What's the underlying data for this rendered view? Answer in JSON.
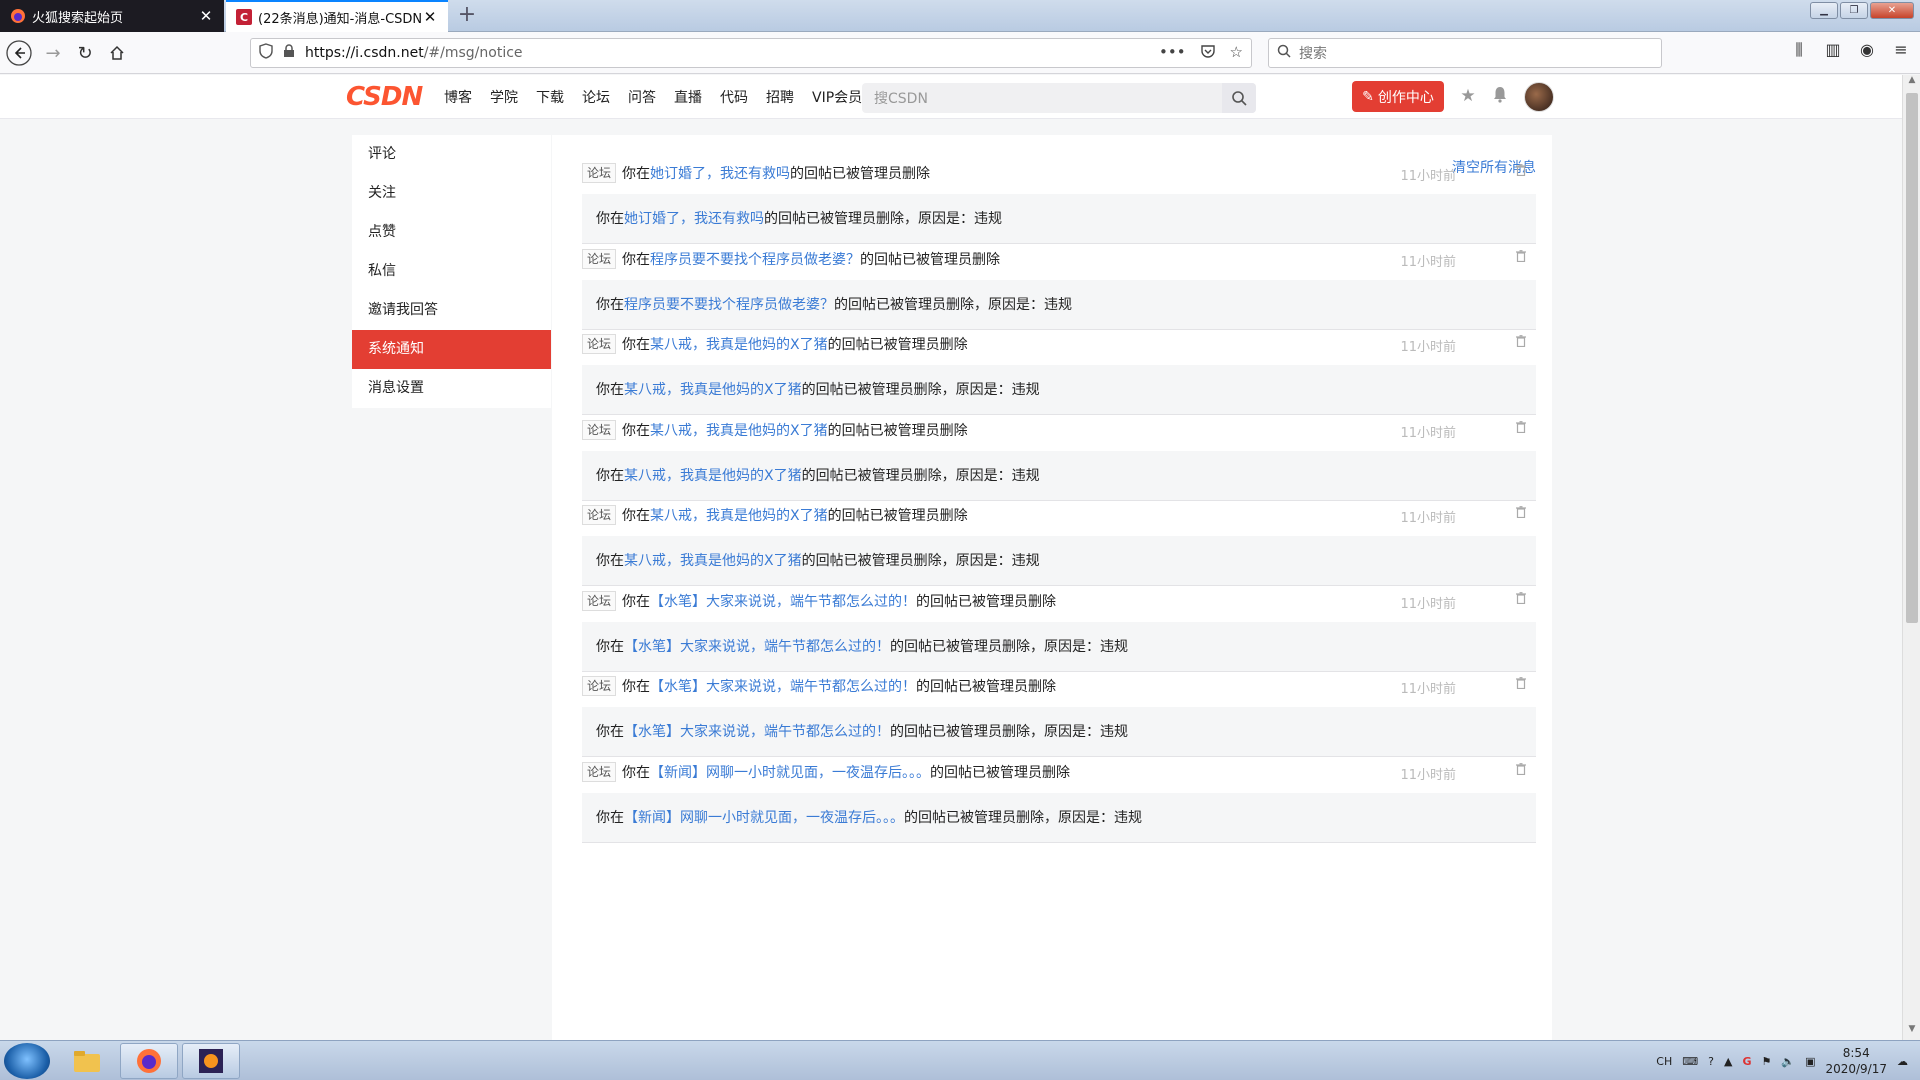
{
  "browser": {
    "tabs": [
      {
        "title": "火狐搜索起始页",
        "active": false
      },
      {
        "title": "(22条消息)通知-消息-CSDN",
        "active": true
      }
    ],
    "url_host": "https://i.csdn.net",
    "url_path": "/#/msg/notice",
    "search_placeholder": "搜索"
  },
  "site": {
    "logo": "CSDN",
    "nav": [
      "博客",
      "学院",
      "下载",
      "论坛",
      "问答",
      "直播",
      "代码",
      "招聘",
      "VIP会员"
    ],
    "search_placeholder": "搜CSDN",
    "create_label": "创作中心",
    "colors": {
      "brand": "#fc5531",
      "active": "#e33e33",
      "link": "#3a7bd5"
    }
  },
  "sidebar": {
    "items": [
      {
        "label": "评论",
        "active": false
      },
      {
        "label": "关注",
        "active": false
      },
      {
        "label": "点赞",
        "active": false
      },
      {
        "label": "私信",
        "active": false
      },
      {
        "label": "邀请我回答",
        "active": false
      },
      {
        "label": "系统通知",
        "active": true
      },
      {
        "label": "消息设置",
        "active": false
      }
    ]
  },
  "main": {
    "clear_all": "清空所有消息",
    "messages": [
      {
        "tag": "论坛",
        "pre": "你在",
        "topic": "她订婚了，我还有救吗",
        "post": "的回帖已被管理员删除",
        "time": "11小时前",
        "body_pre": "你在",
        "body_topic": "她订婚了，我还有救吗",
        "body_post": "的回帖已被管理员删除，原因是：违规"
      },
      {
        "tag": "论坛",
        "pre": "你在",
        "topic": "程序员要不要找个程序员做老婆？",
        "post": "的回帖已被管理员删除",
        "time": "11小时前",
        "body_pre": "你在",
        "body_topic": "程序员要不要找个程序员做老婆？",
        "body_post": "的回帖已被管理员删除，原因是：违规"
      },
      {
        "tag": "论坛",
        "pre": "你在",
        "topic": "某八戒，我真是他妈的X了猪",
        "post": "的回帖已被管理员删除",
        "time": "11小时前",
        "body_pre": "你在",
        "body_topic": "某八戒，我真是他妈的X了猪",
        "body_post": "的回帖已被管理员删除，原因是：违规"
      },
      {
        "tag": "论坛",
        "pre": "你在",
        "topic": "某八戒，我真是他妈的X了猪",
        "post": "的回帖已被管理员删除",
        "time": "11小时前",
        "body_pre": "你在",
        "body_topic": "某八戒，我真是他妈的X了猪",
        "body_post": "的回帖已被管理员删除，原因是：违规"
      },
      {
        "tag": "论坛",
        "pre": "你在",
        "topic": "某八戒，我真是他妈的X了猪",
        "post": "的回帖已被管理员删除",
        "time": "11小时前",
        "body_pre": "你在",
        "body_topic": "某八戒，我真是他妈的X了猪",
        "body_post": "的回帖已被管理员删除，原因是：违规"
      },
      {
        "tag": "论坛",
        "pre": "你在",
        "topic": "【水笔】大家来说说，端午节都怎么过的！",
        "post": "的回帖已被管理员删除",
        "time": "11小时前",
        "body_pre": "你在",
        "body_topic": "【水笔】大家来说说，端午节都怎么过的！",
        "body_post": "的回帖已被管理员删除，原因是：违规"
      },
      {
        "tag": "论坛",
        "pre": "你在",
        "topic": "【水笔】大家来说说，端午节都怎么过的！",
        "post": "的回帖已被管理员删除",
        "time": "11小时前",
        "body_pre": "你在",
        "body_topic": "【水笔】大家来说说，端午节都怎么过的！",
        "body_post": "的回帖已被管理员删除，原因是：违规"
      },
      {
        "tag": "论坛",
        "pre": "你在",
        "topic": "【新闻】网聊一小时就见面，一夜温存后。。。",
        "post": "的回帖已被管理员删除",
        "time": "11小时前",
        "body_pre": "你在",
        "body_topic": "【新闻】网聊一小时就见面，一夜温存后。。。",
        "body_post": "的回帖已被管理员删除，原因是：违规"
      }
    ]
  },
  "taskbar": {
    "apps": [
      "file-explorer",
      "firefox",
      "java-ee-ide"
    ],
    "tray_lang": "CH",
    "time": "8:54",
    "date": "2020/9/17"
  }
}
